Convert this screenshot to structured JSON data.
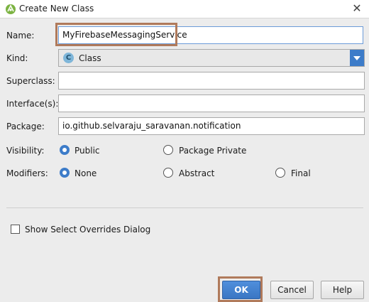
{
  "window": {
    "title": "Create New Class",
    "close_glyph": "✕"
  },
  "form": {
    "name_label": "Name:",
    "name_value": "MyFirebaseMessagingService",
    "kind_label": "Kind:",
    "kind_value": "Class",
    "kind_icon_letter": "C",
    "superclass_label": "Superclass:",
    "superclass_value": "",
    "interfaces_label": "Interface(s):",
    "interfaces_value": "",
    "package_label": "Package:",
    "package_value": "io.github.selvaraju_saravanan.notification",
    "visibility_label": "Visibility:",
    "visibility_options": [
      "Public",
      "Package Private"
    ],
    "modifiers_label": "Modifiers:",
    "modifiers_options": [
      "None",
      "Abstract",
      "Final"
    ],
    "overrides_label": "Show Select Overrides Dialog"
  },
  "buttons": {
    "ok": "OK",
    "cancel": "Cancel",
    "help": "Help"
  },
  "colors": {
    "accent": "#3d7cc9",
    "highlight": "#b07a5b"
  }
}
